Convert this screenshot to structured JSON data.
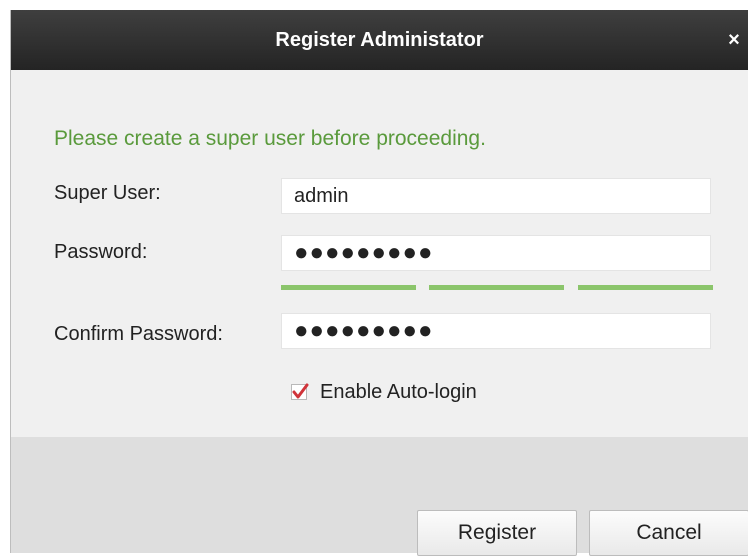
{
  "dialog": {
    "title": "Register Administator",
    "close_label": "×"
  },
  "form": {
    "prompt": "Please create a super user before proceeding.",
    "super_user_label": "Super User:",
    "super_user_value": "admin",
    "password_label": "Password:",
    "password_value": "●●●●●●●●●",
    "confirm_label": "Confirm Password:",
    "confirm_value": "●●●●●●●●●",
    "password_strength_segments_filled": 3,
    "auto_login_label": "Enable Auto-login",
    "auto_login_checked": true
  },
  "buttons": {
    "register": "Register",
    "cancel": "Cancel"
  },
  "colors": {
    "title_bar": "#2f2f2f",
    "prompt_text": "#5a9a3c",
    "strength_bar": "#8bc56b",
    "checkmark": "#d0343a"
  },
  "icons": {
    "close": "close-icon",
    "checkbox": "checkmark-icon"
  }
}
